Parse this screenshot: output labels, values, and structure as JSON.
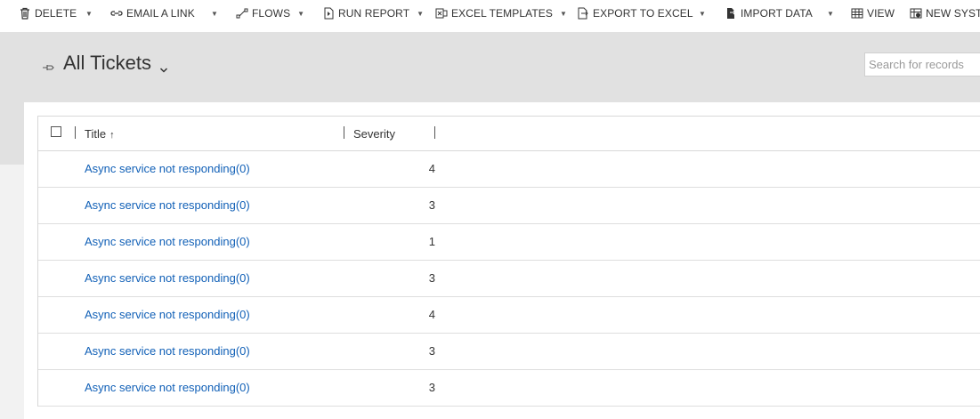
{
  "command_bar": {
    "delete": "DELETE",
    "email_link": "EMAIL A LINK",
    "flows": "FLOWS",
    "run_report": "RUN REPORT",
    "excel_templates": "EXCEL TEMPLATES",
    "export_to_excel": "EXPORT TO EXCEL",
    "import_data": "IMPORT DATA",
    "view": "VIEW",
    "new_system": "NEW SYSTE"
  },
  "header": {
    "view_title": "All Tickets",
    "search_placeholder": "Search for records"
  },
  "grid": {
    "columns": {
      "title": "Title",
      "severity": "Severity"
    },
    "sort_icon": "↑",
    "rows": [
      {
        "title": "Async service not responding(0)",
        "severity": "4"
      },
      {
        "title": "Async service not responding(0)",
        "severity": "3"
      },
      {
        "title": "Async service not responding(0)",
        "severity": "1"
      },
      {
        "title": "Async service not responding(0)",
        "severity": "3"
      },
      {
        "title": "Async service not responding(0)",
        "severity": "4"
      },
      {
        "title": "Async service not responding(0)",
        "severity": "3"
      },
      {
        "title": "Async service not responding(0)",
        "severity": "3"
      }
    ]
  },
  "colors": {
    "link": "#1160b7",
    "header_bg": "#e1e1e1"
  }
}
